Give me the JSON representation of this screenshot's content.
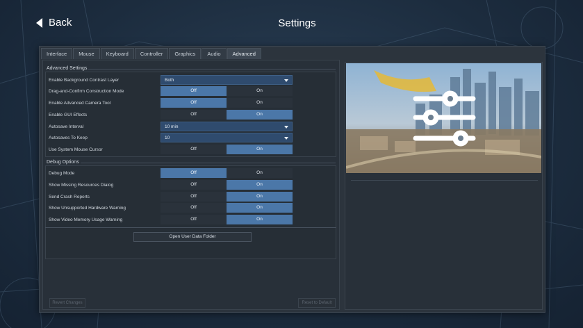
{
  "header": {
    "back_label": "Back",
    "title": "Settings"
  },
  "tabs": [
    {
      "label": "Interface",
      "active": false
    },
    {
      "label": "Mouse",
      "active": false
    },
    {
      "label": "Keyboard",
      "active": false
    },
    {
      "label": "Controller",
      "active": false
    },
    {
      "label": "Graphics",
      "active": false
    },
    {
      "label": "Audio",
      "active": false
    },
    {
      "label": "Advanced",
      "active": true
    }
  ],
  "advanced": {
    "title": "Advanced Settings",
    "rows": [
      {
        "label": "Enable Background Contrast Layer",
        "type": "select",
        "value": "Both"
      },
      {
        "label": "Drag-and-Confirm Construction Mode",
        "type": "toggle",
        "off": "Off",
        "on": "On",
        "selected": "off"
      },
      {
        "label": "Enable Advanced Camera Tool",
        "type": "toggle",
        "off": "Off",
        "on": "On",
        "selected": "off"
      },
      {
        "label": "Enable GUI Effects",
        "type": "toggle",
        "off": "Off",
        "on": "On",
        "selected": "on"
      },
      {
        "label": "Autosave Interval",
        "type": "select",
        "value": "10 min"
      },
      {
        "label": "Autosaves To Keep",
        "type": "select",
        "value": "10"
      },
      {
        "label": "Use System Mouse Cursor",
        "type": "toggle",
        "off": "Off",
        "on": "On",
        "selected": "on"
      }
    ]
  },
  "debug": {
    "title": "Debug Options",
    "rows": [
      {
        "label": "Debug Mode",
        "off": "Off",
        "on": "On",
        "selected": "off"
      },
      {
        "label": "Show Missing Resources Dialog",
        "off": "Off",
        "on": "On",
        "selected": "on"
      },
      {
        "label": "Send Crash Reports",
        "off": "Off",
        "on": "On",
        "selected": "on"
      },
      {
        "label": "Show Unsupported Hardware Warning",
        "off": "Off",
        "on": "On",
        "selected": "on"
      },
      {
        "label": "Show Video Memory Usage Warning",
        "off": "Off",
        "on": "On",
        "selected": "on"
      }
    ],
    "open_folder_label": "Open User Data Folder"
  },
  "footer": {
    "revert_label": "Revert Changes",
    "reset_label": "Reset to Default"
  },
  "colors": {
    "accent": "#4b77a8",
    "select_bg": "#2f4b6e",
    "panel": "#283039",
    "background": "#1c2c3e"
  },
  "preview_icon": "sliders-icon"
}
